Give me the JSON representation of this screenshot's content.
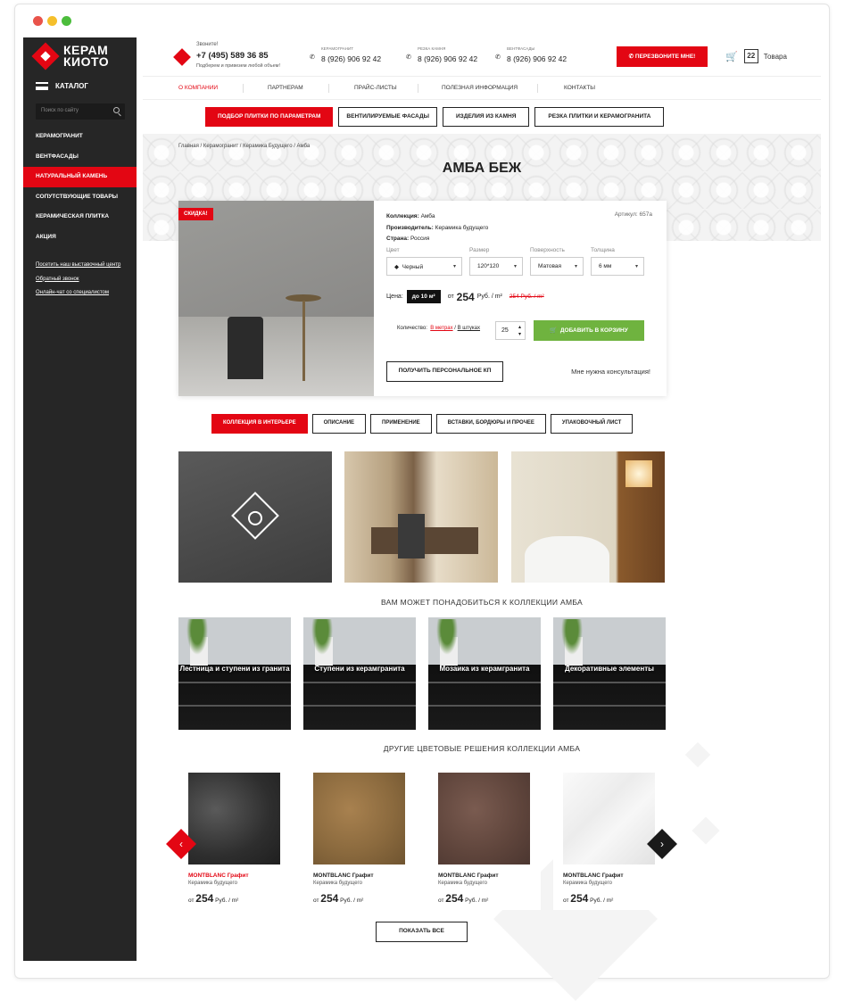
{
  "window": {
    "dots": [
      "#e9534a",
      "#f5bf2b",
      "#4cbd3c"
    ]
  },
  "brand": {
    "line1": "КЕРАМ",
    "line2": "КИОТО",
    "accent": "#e30613"
  },
  "sidebar": {
    "catalog_label": "КАТАЛОГ",
    "search_placeholder": "Поиск по сайту",
    "items": [
      "Керамогранит",
      "Вентфасады",
      "Натуральный камень",
      "Сопутствующие товары",
      "Керамическая плитка",
      "Акция"
    ],
    "links": [
      "Посетить наш выставочный центр",
      "Обратный звонок",
      "Онлайн-чат со специалистом"
    ]
  },
  "header": {
    "call_label": "Звоните!",
    "main_phone": "+7 (495) 589 36 85",
    "call_sub": "Подберем и привезем любой объем!",
    "phones": [
      {
        "label": "КЕРАМОГРАНИТ",
        "number": "8 (926) 906 92 42"
      },
      {
        "label": "РЕЗКА КАМНЯ",
        "number": "8 (926) 906 92 42"
      },
      {
        "label": "ВЕНТФАСАДЫ",
        "number": "8 (926) 906 92 42"
      }
    ],
    "callback_btn": "Перезвоните мне!",
    "cart_count": "22",
    "cart_label": "Товара"
  },
  "nav": [
    "О компании",
    "Партнерам",
    "Прайс-листы",
    "Полезная информация",
    "Контакты"
  ],
  "action_buttons": [
    "Подбор плитки по параметрам",
    "Вентилируемые фасады",
    "Изделия из камня",
    "Резка плитки и керамогранита"
  ],
  "breadcrumbs": "Главная / Керамогранит / Керамика Будущего / Амба",
  "product": {
    "title": "АМБА БЕЖ",
    "badge": "Скидка!",
    "collection_label": "Коллекция:",
    "collection": "Амба",
    "maker_label": "Производитель:",
    "maker": "Керамика будущего",
    "country_label": "Страна:",
    "country": "Россия",
    "article": "Артикул: 657а",
    "color_label": "Цвет",
    "color_value": "Черный",
    "size_label": "Размер",
    "size_value": "120*120",
    "surface_label": "Поверхность",
    "surface_value": "Матовая",
    "thick_label": "Толщина",
    "thick_value": "6 мм",
    "price_label": "Цена:",
    "price_tag": "до 10 м²",
    "price_from": "от",
    "price": "254",
    "price_unit": "Руб. / m²",
    "old_price": "254 Руб. / m²",
    "qty_label": "Количество:",
    "qty_m": "В метрах",
    "qty_sep": " / ",
    "qty_pcs": "В штуках",
    "qty": "25",
    "add_cart": "Добавить в корзину",
    "kp_btn": "Получить персональное КП",
    "consult": "Мне нужна консультация!"
  },
  "tabs": [
    "Коллекция в интерьере",
    "Описание",
    "Применение",
    "Вставки, бордюры и прочее",
    "Упаковочный лист"
  ],
  "related_title": "ВАМ МОЖЕТ ПОНАДОБИТЬСЯ К КОЛЛЕКЦИИ АМБА",
  "related": [
    "Лестница и ступени из гранита",
    "Ступени из керамгранита",
    "Мозаика из керамгранита",
    "Декоративные элементы"
  ],
  "other_title": "ДРУГИЕ ЦВЕТОВЫЕ РЕШЕНИЯ КОЛЛЕКЦИИ АМБА",
  "products": [
    {
      "name": "MONTBLANC Графит",
      "maker": "Керамика будущего",
      "from": "от",
      "price": "254",
      "unit": "Руб. / m²",
      "color": "#e30613"
    },
    {
      "name": "MONTBLANC Графит",
      "maker": "Керамика будущего",
      "from": "от",
      "price": "254",
      "unit": "Руб. / m²",
      "color": "#222222"
    },
    {
      "name": "MONTBLANC Графит",
      "maker": "Керамика будущего",
      "from": "от",
      "price": "254",
      "unit": "Руб. / m²",
      "color": "#222222"
    },
    {
      "name": "MONTBLANC Графит",
      "maker": "Керамика будущего",
      "from": "от",
      "price": "254",
      "unit": "Руб. / m²",
      "color": "#222222"
    }
  ],
  "show_all": "Показать все"
}
